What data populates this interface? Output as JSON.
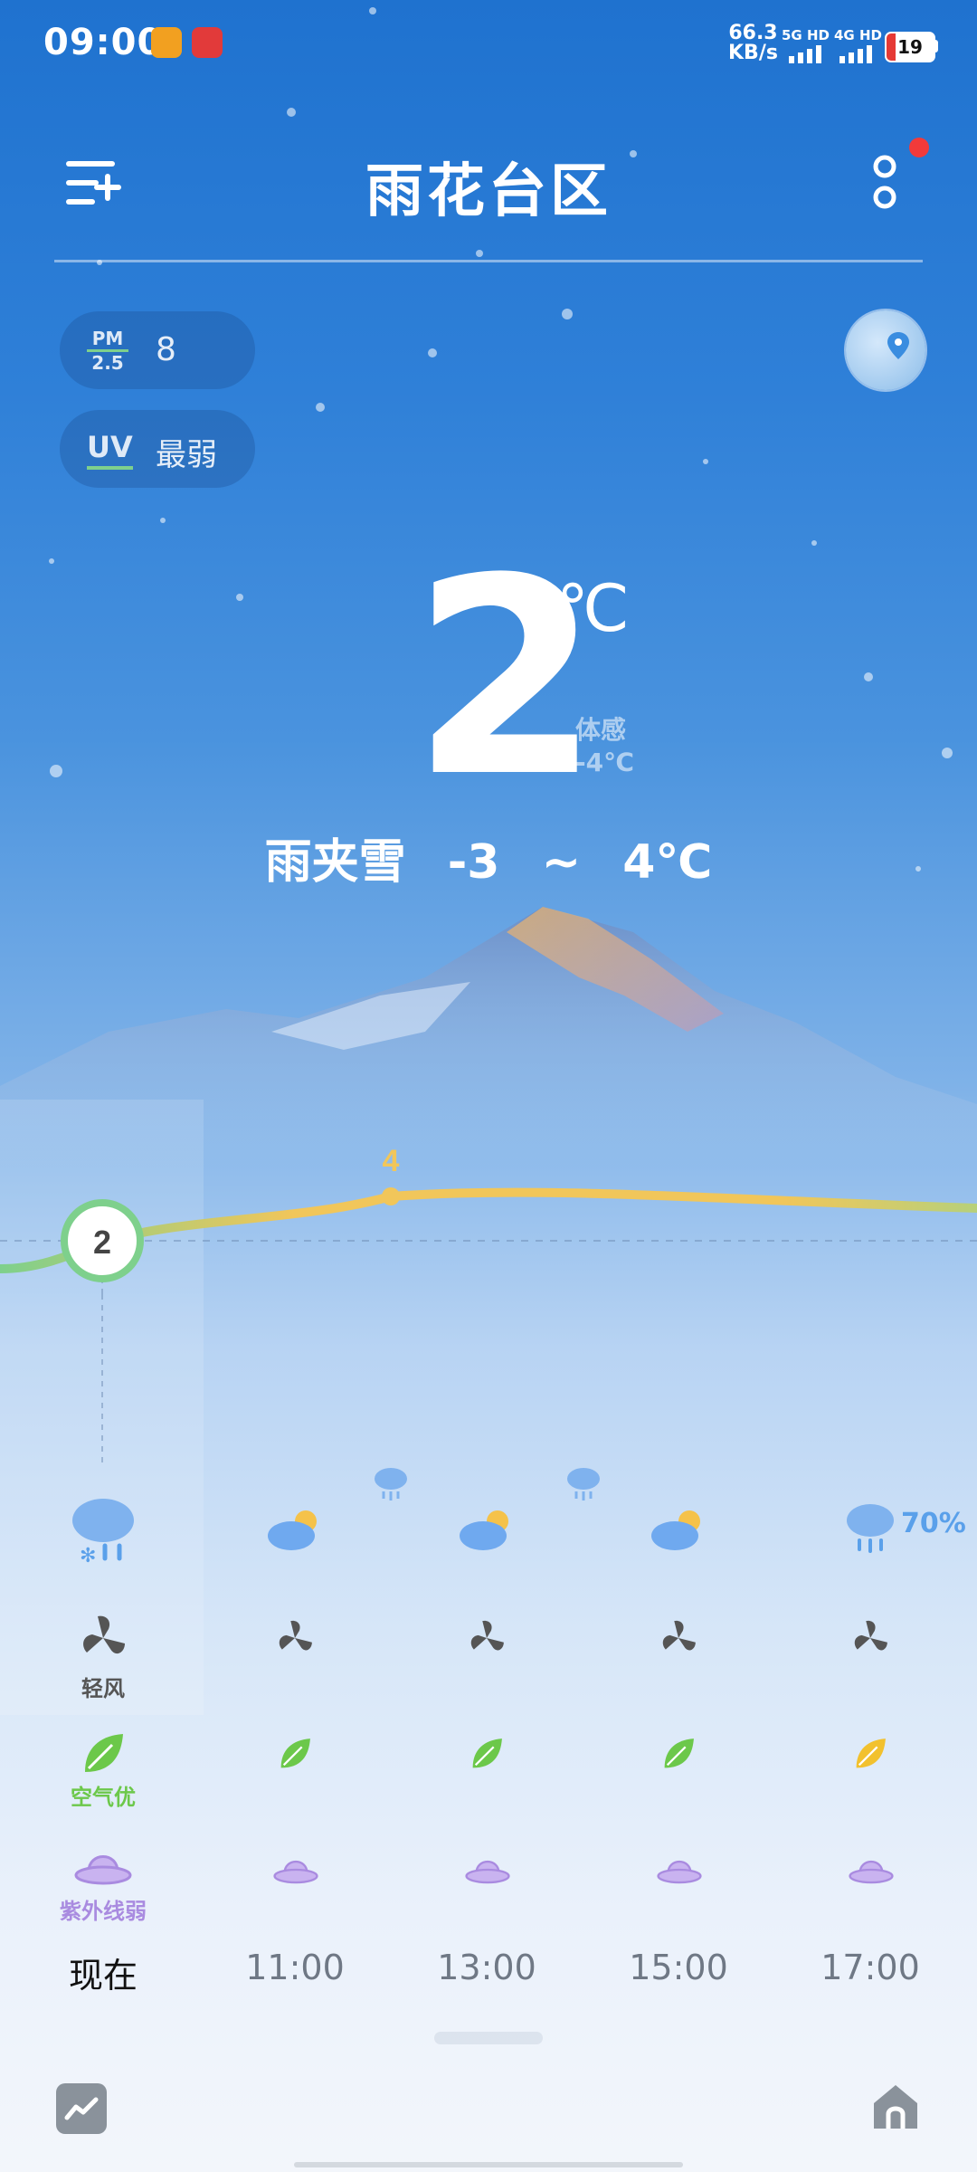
{
  "status_bar": {
    "time": "09:00",
    "net_speed_value": "66.3",
    "net_speed_unit": "KB/s",
    "sim1": "5G HD",
    "sim2": "4G HD",
    "battery": "19"
  },
  "header": {
    "city": "雨花台区"
  },
  "chips": {
    "pm_label_top": "PM",
    "pm_label_bottom": "2.5",
    "pm_value": "8",
    "uv_label": "UV",
    "uv_value": "最弱"
  },
  "current": {
    "temperature": "2",
    "unit": "℃",
    "feels_label": "体感",
    "feels_value": "-4℃",
    "condition": "雨夹雪",
    "range": "-3 ~ 4℃"
  },
  "curve": {
    "current_value": "2",
    "peak_value": "4"
  },
  "forecast": {
    "now": {
      "time": "现在",
      "wind": "轻风",
      "air": "空气优",
      "uv": "紫外线弱"
    },
    "times": [
      "11:00",
      "13:00",
      "15:00",
      "17:00"
    ],
    "rain_probability": "70%"
  },
  "colors": {
    "sky_top": "#1f72cf",
    "curve_green": "#7ed08c",
    "curve_yellow": "#f1c65a",
    "air_green": "#6cc84a",
    "uv_purple": "#a98be0"
  }
}
